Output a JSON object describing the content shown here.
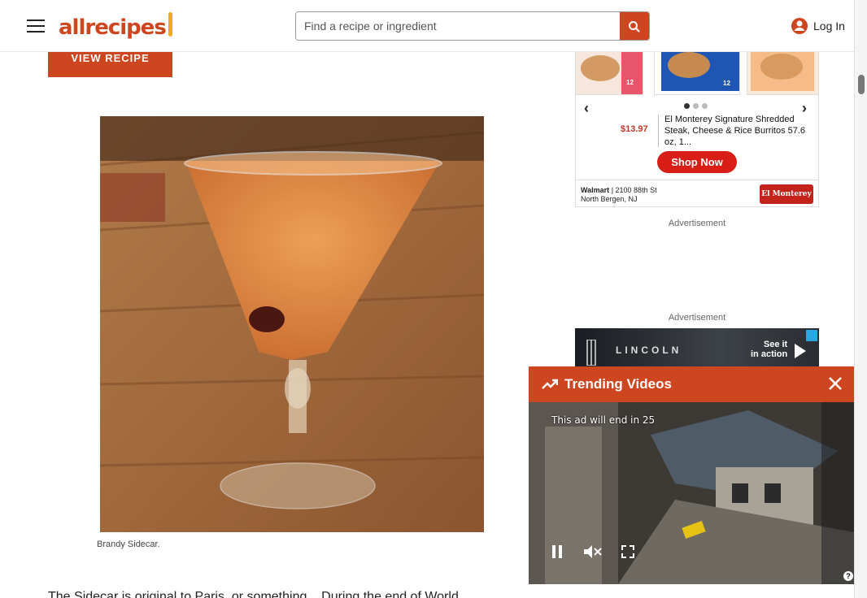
{
  "header": {
    "logo_text": "allrecipes",
    "search_placeholder": "Find a recipe or ingredient",
    "login_label": "Log In"
  },
  "article": {
    "view_recipe_label": "VIEW RECIPE",
    "photo_caption": "Brandy Sidecar.",
    "body_text_partial": "The Sidecar is original to Paris, or something... During the end of World..."
  },
  "ad_product": {
    "price": "$13.97",
    "product_title": "El Monterey Signature Shredded Steak, Cheese & Rice Burritos 57.6 oz, 1...",
    "shop_button": "Shop Now",
    "store_name": "Walmart",
    "store_address_line1": "2100 88th St",
    "store_address_line2": "North Bergen, NJ",
    "brand": "El Monterey",
    "pack_label": "12 PACK",
    "carousel_active_index": 0,
    "carousel_count": 3
  },
  "ad_labels": {
    "label1": "Advertisement",
    "label2": "Advertisement"
  },
  "ad_lincoln": {
    "brand": "LINCOLN",
    "cta_line1": "See it",
    "cta_line2": "in action"
  },
  "trending": {
    "title": "Trending Videos",
    "ad_countdown": "This ad will end in 25"
  },
  "colors": {
    "brand_orange": "#ce4620",
    "shop_red": "#d81e16"
  }
}
